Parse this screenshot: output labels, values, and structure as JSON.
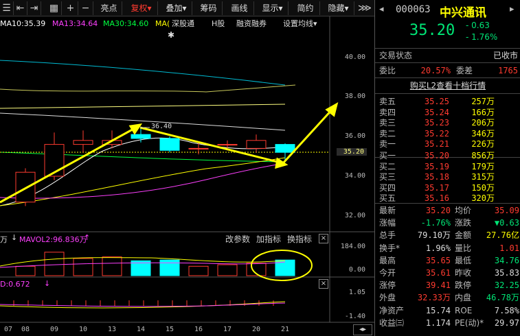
{
  "toolbar": {
    "items": [
      {
        "label": "亮点"
      },
      {
        "label": "复权▾"
      },
      {
        "label": "叠加▾"
      },
      {
        "label": "筹码"
      },
      {
        "label": "画线"
      },
      {
        "label": "显示▾"
      },
      {
        "label": "简约"
      },
      {
        "label": "隐藏▾"
      }
    ]
  },
  "legend": {
    "ma10": "MA10:35.39",
    "ma13": "MA13:34.64",
    "ma30": "MA30:34.60",
    "maX": "MA(",
    "shgt": "深股通",
    "h": "H股",
    "rzrq": "融资融券",
    "set_ma": "设置均线▾",
    "colors": {
      "ma10": "#ffffff",
      "ma13": "#ff40ff",
      "ma30": "#00ff40",
      "ma50": "#ffff00"
    }
  },
  "price_axis": [
    "40.00",
    "38.00",
    "36.00",
    "35.20",
    "34.00",
    "32.00"
  ],
  "high_mark": "36.40",
  "volume_pane": {
    "prefix": "万",
    "label": "MAVOL2:96.836万",
    "axis": [
      "184.00",
      "0.00"
    ],
    "links": [
      "改参数",
      "加指标",
      "换指标"
    ]
  },
  "macd_pane": {
    "label": "D:0.672",
    "axis": [
      "1.05",
      "-1.40"
    ]
  },
  "x_axis": [
    "07",
    "08",
    "09",
    "10",
    "13",
    "14",
    "15",
    "16",
    "17",
    "20",
    "21"
  ],
  "quote": {
    "code": "000063",
    "name": "中兴通讯",
    "price": "35.20",
    "change": "- 0.63",
    "change_pct": "- 1.76%",
    "trade_status_label": "交易状态",
    "trade_status": "已收市",
    "wb_label": "委比",
    "wb": "20.57%",
    "wc_label": "委差",
    "wc": "1765",
    "l2_link": "购买L2查看十档行情",
    "asks": [
      {
        "label": "卖五",
        "price": "35.25",
        "vol": "257万"
      },
      {
        "label": "卖四",
        "price": "35.24",
        "vol": "166万"
      },
      {
        "label": "卖三",
        "price": "35.23",
        "vol": "206万"
      },
      {
        "label": "卖二",
        "price": "35.22",
        "vol": "346万"
      },
      {
        "label": "卖一",
        "price": "35.21",
        "vol": "226万"
      }
    ],
    "bids": [
      {
        "label": "买一",
        "price": "35.20",
        "vol": "856万"
      },
      {
        "label": "买二",
        "price": "35.19",
        "vol": "179万"
      },
      {
        "label": "买三",
        "price": "35.18",
        "vol": "315万"
      },
      {
        "label": "买四",
        "price": "35.17",
        "vol": "150万"
      },
      {
        "label": "买五",
        "price": "35.16",
        "vol": "320万"
      }
    ],
    "stats": [
      {
        "l1": "最新",
        "v1": "35.20",
        "c1": "red",
        "l2": "均价",
        "v2": "35.09",
        "c2": "red"
      },
      {
        "l1": "涨幅",
        "v1": "-1.76%",
        "c1": "green",
        "l2": "涨跌",
        "v2": "▼0.63",
        "c2": "green"
      },
      {
        "l1": "总手",
        "v1": "79.10万",
        "c1": "white",
        "l2": "金额",
        "v2": "27.76亿",
        "c2": "yellow"
      },
      {
        "l1": "换手*",
        "v1": "1.96%",
        "c1": "white",
        "l2": "量比",
        "v2": "1.01",
        "c2": "red"
      },
      {
        "l1": "最高",
        "v1": "35.65",
        "c1": "red",
        "l2": "最低",
        "v2": "34.76",
        "c2": "green"
      },
      {
        "l1": "今开",
        "v1": "35.61",
        "c1": "red",
        "l2": "昨收",
        "v2": "35.83",
        "c2": "white"
      },
      {
        "l1": "涨停",
        "v1": "39.41",
        "c1": "red",
        "l2": "跌停",
        "v2": "32.25",
        "c2": "green"
      },
      {
        "l1": "外盘",
        "v1": "32.33万",
        "c1": "red",
        "l2": "内盘",
        "v2": "46.78万",
        "c2": "green"
      },
      {
        "l1": "净资产",
        "v1": "15.74",
        "c1": "white",
        "l2": "ROE",
        "v2": "7.58%",
        "c2": "white"
      },
      {
        "l1": "收益㈢",
        "v1": "1.174",
        "c1": "white",
        "l2": "PE(动)*",
        "v2": "29.97",
        "c2": "white"
      }
    ]
  },
  "chart_data": {
    "type": "candlestick",
    "categories": [
      "07",
      "08",
      "09",
      "10",
      "13",
      "14",
      "15",
      "16",
      "17",
      "20",
      "21"
    ],
    "candles": [
      {
        "x": "07",
        "open": 32.6,
        "close": 32.3,
        "high": 33.0,
        "low": 31.9
      },
      {
        "x": "08",
        "open": 32.7,
        "close": 34.2,
        "high": 34.4,
        "low": 32.5
      },
      {
        "x": "09",
        "open": 34.0,
        "close": 35.6,
        "high": 36.2,
        "low": 33.8
      },
      {
        "x": "10",
        "open": 35.6,
        "close": 35.8,
        "high": 36.3,
        "low": 35.2
      },
      {
        "x": "13",
        "open": 35.6,
        "close": 35.8,
        "high": 36.3,
        "low": 35.4
      },
      {
        "x": "14",
        "open": 36.1,
        "close": 35.9,
        "high": 36.4,
        "low": 35.7
      },
      {
        "x": "15",
        "open": 35.9,
        "close": 35.3,
        "high": 36.0,
        "low": 35.2
      },
      {
        "x": "16",
        "open": 35.4,
        "close": 35.4,
        "high": 35.7,
        "low": 35.1
      },
      {
        "x": "17",
        "open": 35.6,
        "close": 35.6,
        "high": 35.8,
        "low": 35.3
      },
      {
        "x": "20",
        "open": 35.4,
        "close": 35.8,
        "high": 36.1,
        "low": 35.2
      },
      {
        "x": "21",
        "open": 35.6,
        "close": 35.2,
        "high": 35.65,
        "low": 34.76
      }
    ],
    "ylim": [
      31.2,
      41.0
    ],
    "volume": [
      45,
      60,
      150,
      110,
      120,
      95,
      100,
      60,
      70,
      80,
      100
    ],
    "volume_ylim": [
      0,
      184
    ]
  }
}
